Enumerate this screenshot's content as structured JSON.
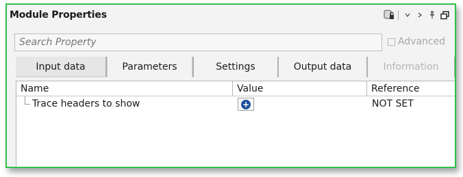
{
  "window": {
    "title": "Module Properties",
    "title_icons": [
      "db-lock-icon",
      "chevron-down-icon",
      "chevron-right-icon",
      "pin-icon",
      "restore-window-icon"
    ]
  },
  "search": {
    "placeholder": "Search Property",
    "value": ""
  },
  "advanced": {
    "label": "Advanced",
    "checked": false,
    "enabled": false
  },
  "tabs": [
    {
      "label": "Input data",
      "active": false,
      "enabled": true
    },
    {
      "label": "Parameters",
      "active": true,
      "enabled": true
    },
    {
      "label": "Settings",
      "active": false,
      "enabled": true
    },
    {
      "label": "Output data",
      "active": false,
      "enabled": true
    },
    {
      "label": "Information",
      "active": false,
      "enabled": false
    }
  ],
  "grid": {
    "columns": [
      "Name",
      "Value",
      "Reference"
    ],
    "rows": [
      {
        "name": "Trace headers to show",
        "value_button_icon": "plus-circle-icon",
        "reference": "NOT SET"
      }
    ]
  },
  "colors": {
    "border": "#2fbf4a",
    "plus_icon": "#1e4d9b"
  }
}
